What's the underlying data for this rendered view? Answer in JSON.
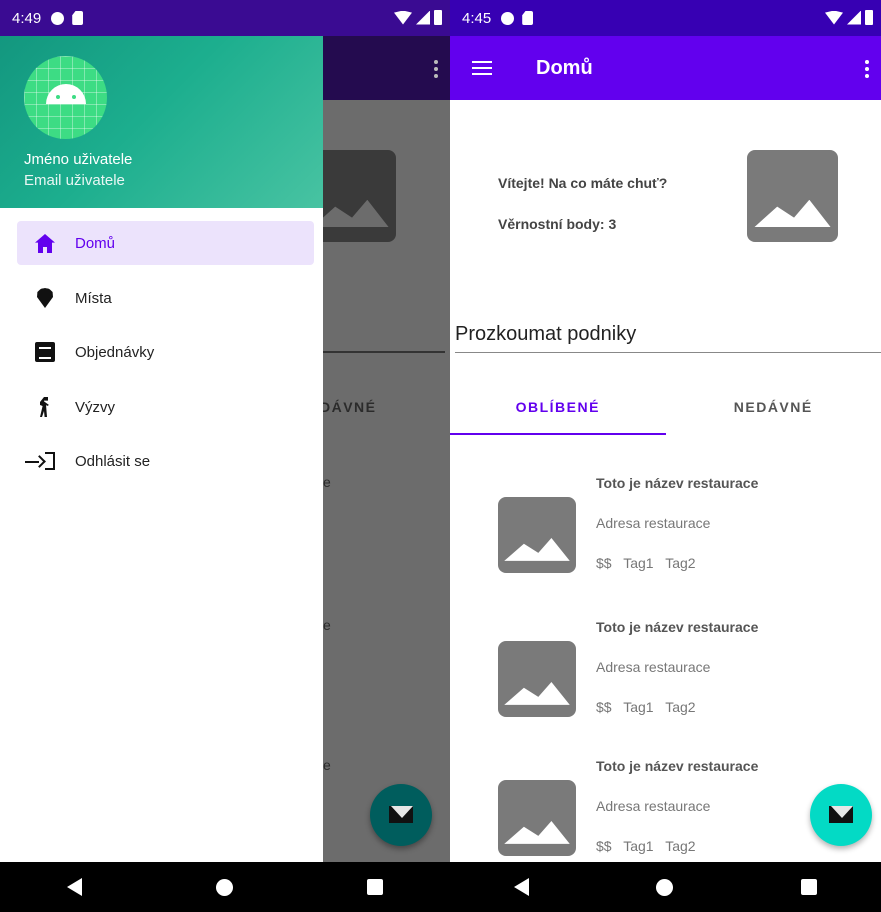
{
  "left_screen": {
    "status_time": "4:49",
    "drawer": {
      "user_name": "Jméno uživatele",
      "user_email": "Email uživatele",
      "items": [
        {
          "label": "Domů",
          "icon": "home-icon",
          "active": true
        },
        {
          "label": "Místa",
          "icon": "place-icon"
        },
        {
          "label": "Objednávky",
          "icon": "orders-icon"
        },
        {
          "label": "Výzvy",
          "icon": "challenges-icon"
        },
        {
          "label": "Odhlásit se",
          "icon": "logout-icon"
        }
      ]
    },
    "background_fragments": {
      "tab_fragment": "DÁVNÉ",
      "e1": "e",
      "e2": "e",
      "e3": "e"
    }
  },
  "right_screen": {
    "status_time": "4:45",
    "appbar_title": "Domů",
    "welcome_text": "Vítejte! Na co  máte chuť?",
    "loyalty_text": "Věrnostní body: 3",
    "section_title": "Prozkoumat podniky",
    "tabs": [
      {
        "label": "OBLÍBENÉ",
        "active": true
      },
      {
        "label": "NEDÁVNÉ",
        "active": false
      }
    ],
    "restaurants": [
      {
        "name": "Toto je název restaurace",
        "address": "Adresa restaurace",
        "tags": "$$ Tag1 Tag2"
      },
      {
        "name": "Toto je název restaurace",
        "address": "Adresa restaurace",
        "tags": "$$ Tag1 Tag2"
      },
      {
        "name": "Toto je název restaurace",
        "address": "Adresa restaurace",
        "tags": "$$ Tag1 Tag2"
      }
    ]
  },
  "colors": {
    "primary": "#6200ee",
    "primary_dark": "#3700b3",
    "accent": "#03dac5",
    "drawer_header": "#1cae8e"
  }
}
